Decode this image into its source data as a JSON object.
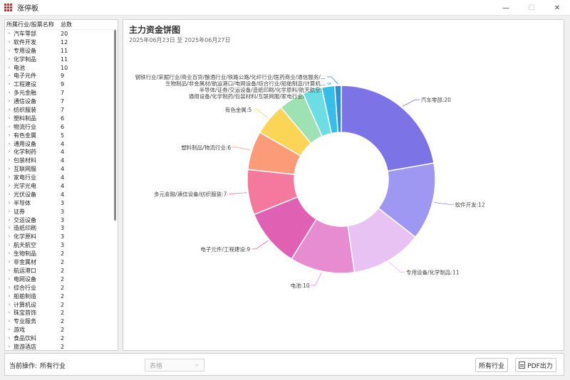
{
  "window": {
    "title": "涨停板",
    "min_icon": "minimize-icon",
    "max_icon": "maximize-icon",
    "close_icon": "close-icon"
  },
  "tree": {
    "header_name": "所属行业/股票名称",
    "header_count": "总数",
    "rows": [
      {
        "name": "汽车零部",
        "count": "20"
      },
      {
        "name": "软件开发",
        "count": "12"
      },
      {
        "name": "专用设备",
        "count": "11"
      },
      {
        "name": "化学制品",
        "count": "11"
      },
      {
        "name": "电池",
        "count": "10"
      },
      {
        "name": "电子元件",
        "count": "9"
      },
      {
        "name": "工程建设",
        "count": "9"
      },
      {
        "name": "多元金融",
        "count": "7"
      },
      {
        "name": "通信设备",
        "count": "7"
      },
      {
        "name": "纺织服装",
        "count": "7"
      },
      {
        "name": "塑料制品",
        "count": "6"
      },
      {
        "name": "物流行业",
        "count": "6"
      },
      {
        "name": "有色金属",
        "count": "5"
      },
      {
        "name": "通用设备",
        "count": "4"
      },
      {
        "name": "化学制药",
        "count": "4"
      },
      {
        "name": "包装材料",
        "count": "4"
      },
      {
        "name": "互联网服",
        "count": "4"
      },
      {
        "name": "家电行业",
        "count": "4"
      },
      {
        "name": "光学光电",
        "count": "4"
      },
      {
        "name": "光伏设备",
        "count": "4"
      },
      {
        "name": "半导体",
        "count": "3"
      },
      {
        "name": "证券",
        "count": "3"
      },
      {
        "name": "交运设备",
        "count": "3"
      },
      {
        "name": "造纸印刷",
        "count": "3"
      },
      {
        "name": "化学原料",
        "count": "3"
      },
      {
        "name": "航天航空",
        "count": "3"
      },
      {
        "name": "生物制品",
        "count": "2"
      },
      {
        "name": "非金属材",
        "count": "2"
      },
      {
        "name": "航运港口",
        "count": "2"
      },
      {
        "name": "电网设备",
        "count": "2"
      },
      {
        "name": "综合行业",
        "count": "2"
      },
      {
        "name": "船舶制造",
        "count": "2"
      },
      {
        "name": "计算机设",
        "count": "2"
      },
      {
        "name": "珠宝首饰",
        "count": "2"
      },
      {
        "name": "专业服务",
        "count": "2"
      },
      {
        "name": "游戏",
        "count": "2"
      },
      {
        "name": "食品饮料",
        "count": "2"
      },
      {
        "name": "旅游酒店",
        "count": "2"
      }
    ]
  },
  "chart_data": {
    "type": "pie",
    "title": "主力资金饼图",
    "subtitle": "2025年06月23日 至 2025年06月27日",
    "slices": [
      {
        "label": "汽车零部:20",
        "value": 20,
        "color": "#7b73e6"
      },
      {
        "label": "软件开发:12",
        "value": 12,
        "color": "#9f98f2"
      },
      {
        "label": "专用设备/化学制品:11",
        "value": 11,
        "color": "#e7c2f3"
      },
      {
        "label": "电池:10",
        "value": 10,
        "color": "#e88cd1"
      },
      {
        "label": "电子元件/工程建设:9",
        "value": 9,
        "color": "#e060b4"
      },
      {
        "label": "多元金融/通信设备/纺织服装:7",
        "value": 7,
        "color": "#f5789e"
      },
      {
        "label": "塑料制品/物流行业:6",
        "value": 6,
        "color": "#fb9b78"
      },
      {
        "label": "有色金属:5",
        "value": 5,
        "color": "#fcd456"
      },
      {
        "label": "通用设备/化学制药/包装材料/互联网服/家电行业/光学光...",
        "value": 4,
        "color": "#9ee2b4"
      },
      {
        "label": "半导体/证券/交运设备/造纸印刷/化学原料/航天航空:3",
        "value": 3,
        "color": "#6ddde4"
      },
      {
        "label": "生物制品/非金属材/航运港口/电网设备/综合行业/船舶制造/计算机...",
        "value": 2,
        "color": "#36bde8"
      },
      {
        "label": "钢铁行业/采掘行业/商业百货/酿酒行业/铁路公路/化纤行业/医药商业/通信服务/...",
        "value": 1,
        "color": "#2b8fd8"
      }
    ]
  },
  "bottom": {
    "op_label": "当前操作:",
    "op_value": "所有行业",
    "select_value": "表格",
    "btn_all": "所有行业",
    "btn_pdf": "PDF出力"
  }
}
